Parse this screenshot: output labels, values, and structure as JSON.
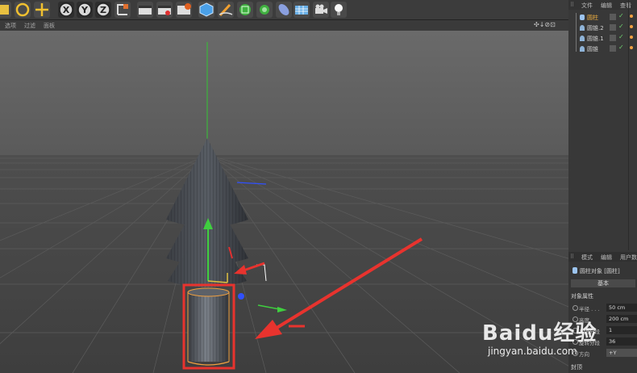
{
  "toolbar": {
    "icons": [
      "select-icon",
      "rotate-icon",
      "move-icon",
      "x-axis-lock-icon",
      "y-axis-lock-icon",
      "z-axis-lock-icon",
      "coordinate-system-icon",
      "render-view-icon",
      "render-picture-queue-icon",
      "render-settings-icon",
      "cube-icon",
      "pen-icon",
      "subdivision-icon",
      "cloner-icon",
      "deformer-icon",
      "floor-icon",
      "camera-icon",
      "light-icon"
    ],
    "axis_labels": [
      "X",
      "Y",
      "Z"
    ]
  },
  "viewport": {
    "menu": [
      "选项",
      "过滤",
      "面板"
    ],
    "nav_icons": "✣↓⊘⊡"
  },
  "object_manager": {
    "menu": [
      "文件",
      "编辑",
      "查看"
    ],
    "objects": [
      {
        "name": "圆柱",
        "selected": true
      },
      {
        "name": "圆锥.2",
        "selected": false
      },
      {
        "name": "圆锥.1",
        "selected": false
      },
      {
        "name": "圆锥",
        "selected": false
      }
    ]
  },
  "attribute_manager": {
    "menu": [
      "模式",
      "编辑",
      "用户数"
    ],
    "title": "圆柱对象 [圆柱]",
    "tab": "基本",
    "section": "对象属性",
    "fields": [
      {
        "label": "半径 . . .",
        "value": "50 cm"
      },
      {
        "label": "高度",
        "value": "200 cm"
      },
      {
        "label": "高度分段",
        "value": "1"
      },
      {
        "label": "旋转分段",
        "value": "36"
      },
      {
        "label": "方向",
        "value": "+Y"
      }
    ],
    "footer": "封顶"
  },
  "watermark": {
    "brand": "Baidu经验",
    "url": "jingyan.baidu.com"
  },
  "colors": {
    "annotation_red": "#e8332e",
    "selection_orange": "#f0a040",
    "y_axis_green": "#3fcf3f",
    "x_axis_red": "#e03030",
    "z_axis_blue": "#3050ff"
  }
}
